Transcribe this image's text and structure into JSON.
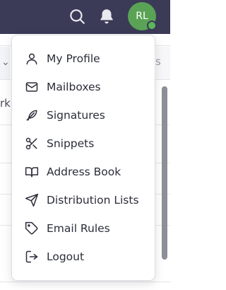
{
  "header": {
    "avatar_initials": "RL",
    "accent_color": "#3b3a57",
    "avatar_color": "#5aa356",
    "presence_color": "#5bb85a",
    "icons": [
      "search-icon",
      "bell-icon"
    ]
  },
  "background": {
    "partial_text_left": "rk",
    "partial_text_right": "s"
  },
  "menu": {
    "items": [
      {
        "label": "My Profile",
        "icon": "user-icon"
      },
      {
        "label": "Mailboxes",
        "icon": "mail-icon"
      },
      {
        "label": "Signatures",
        "icon": "feather-icon"
      },
      {
        "label": "Snippets",
        "icon": "scissors-icon"
      },
      {
        "label": "Address Book",
        "icon": "book-open-icon"
      },
      {
        "label": "Distribution Lists",
        "icon": "send-icon"
      },
      {
        "label": "Email Rules",
        "icon": "tag-icon"
      },
      {
        "label": "Logout",
        "icon": "logout-icon"
      }
    ]
  }
}
